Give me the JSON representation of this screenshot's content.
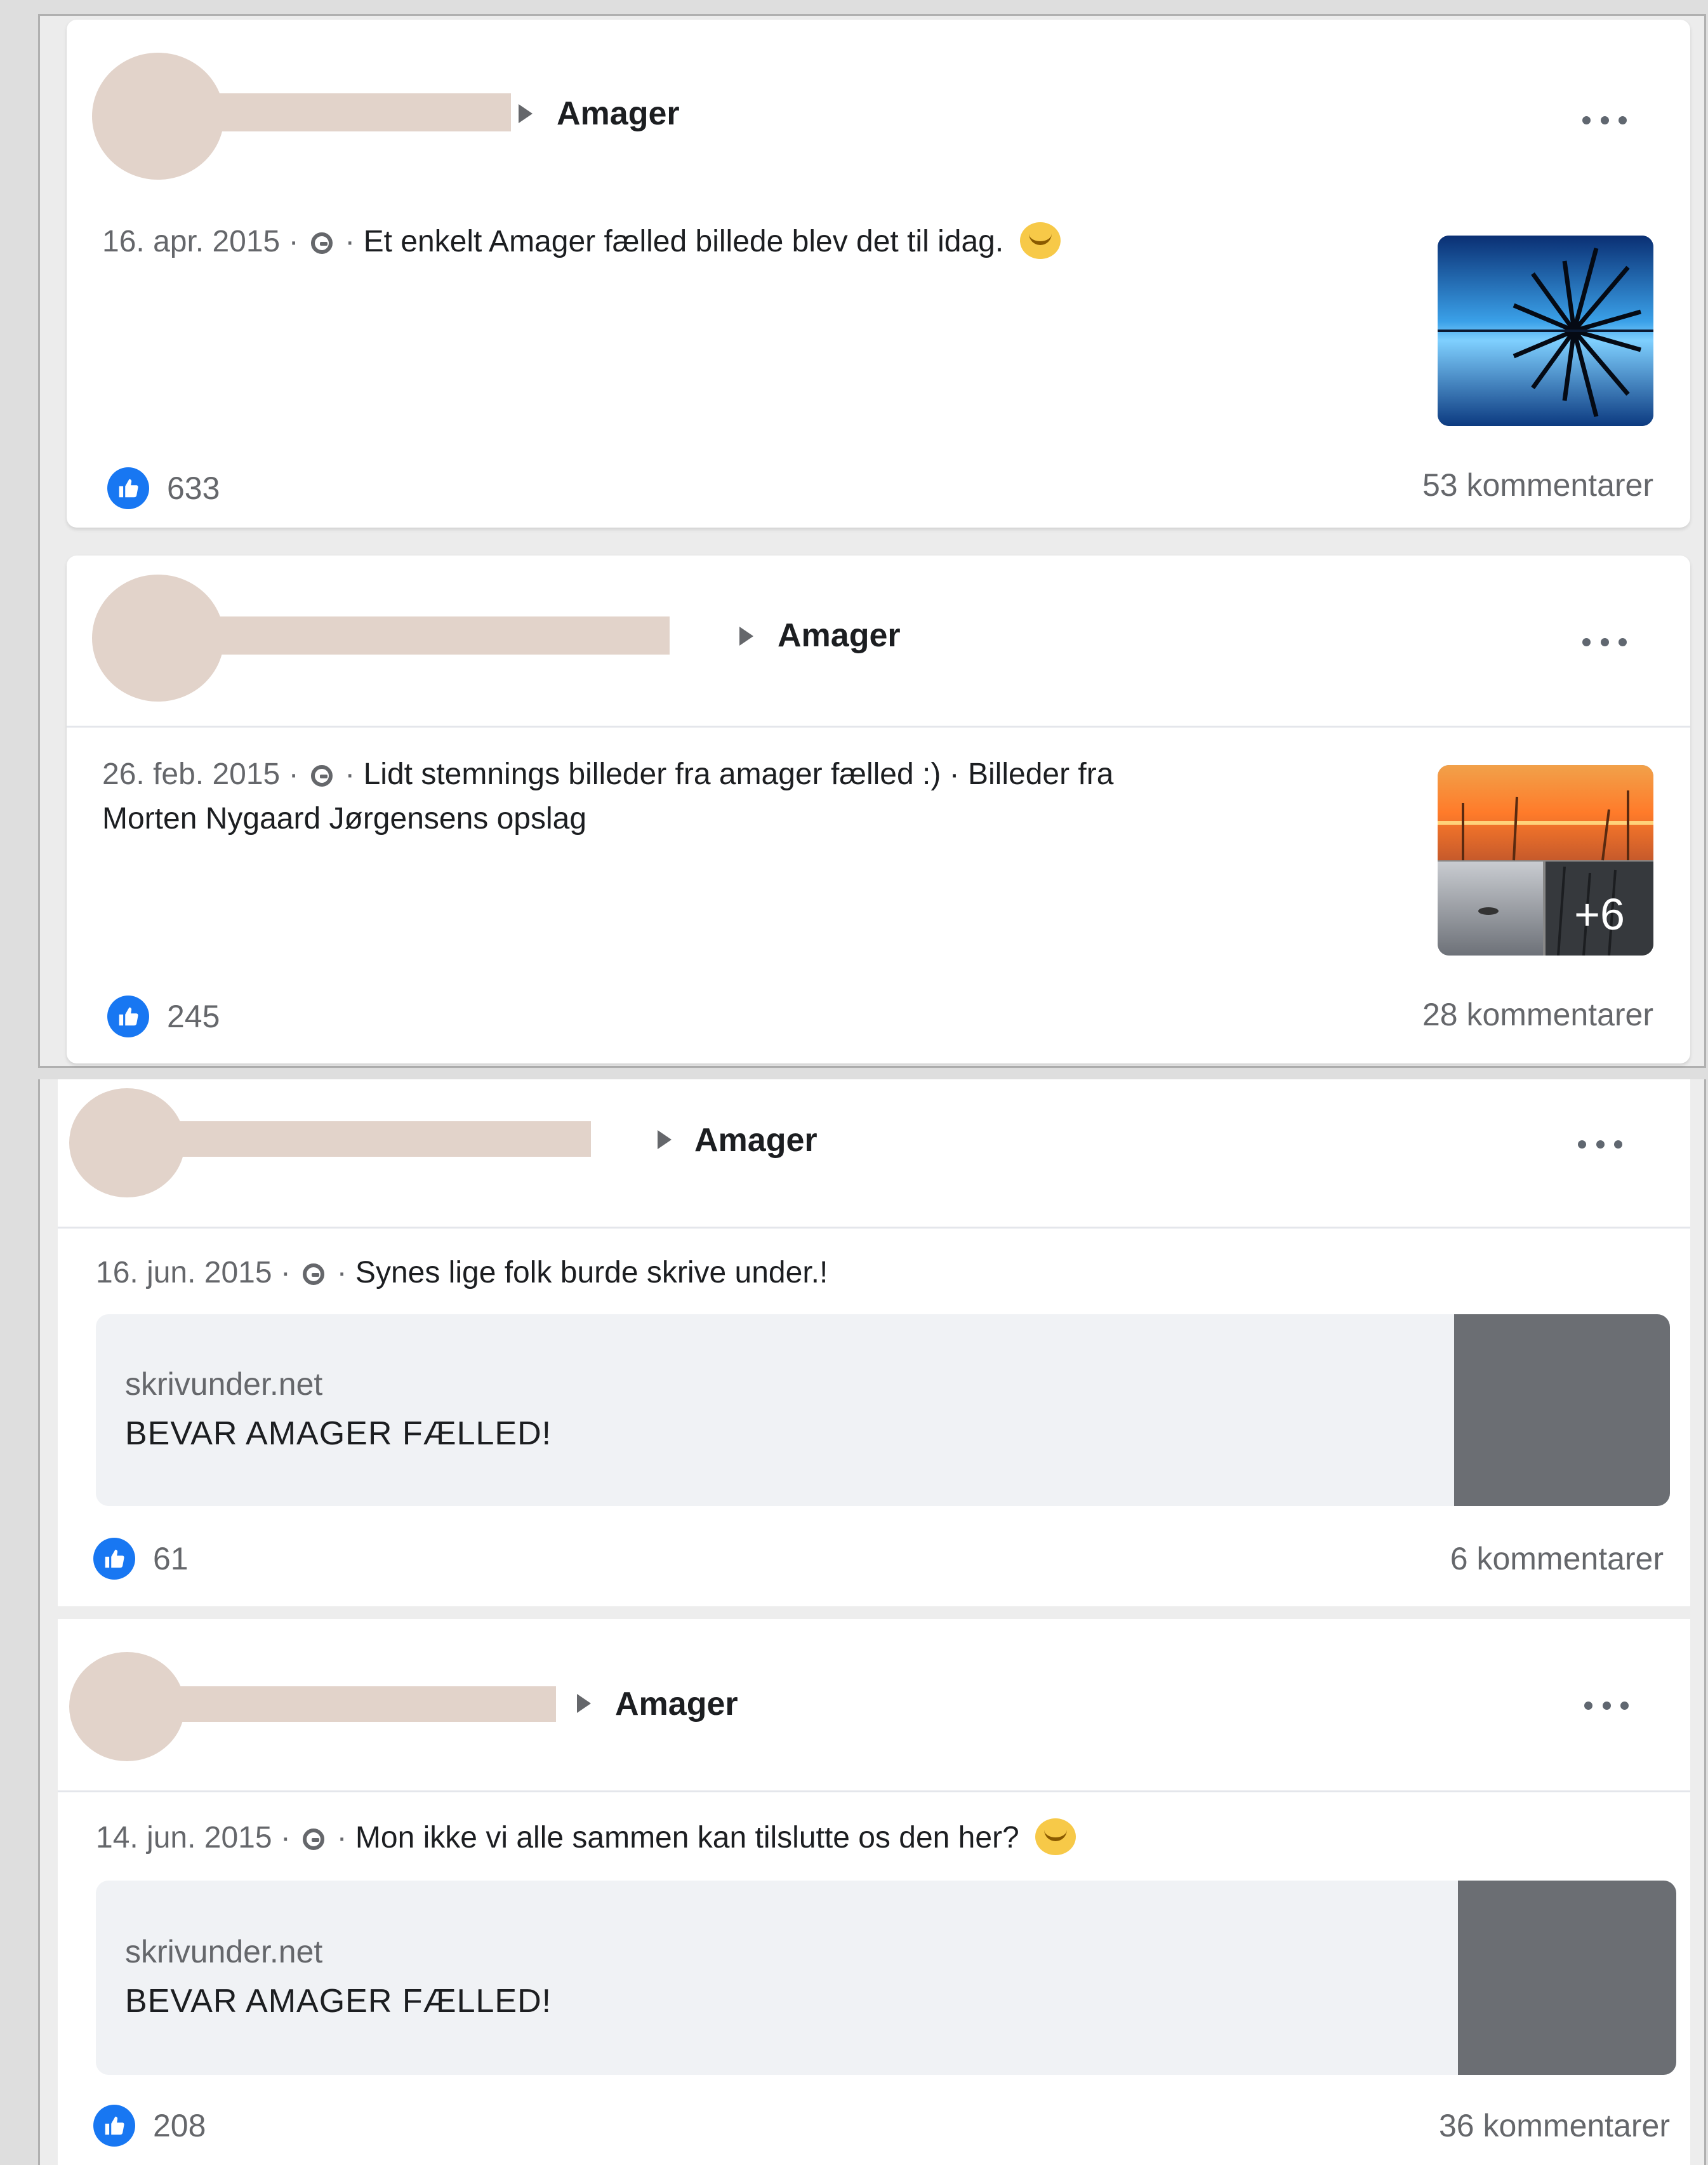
{
  "posts": [
    {
      "group": "Amager",
      "date": "16. apr. 2015",
      "separator": "·",
      "text": "Et enkelt Amager fælled billede blev det til idag.",
      "likes": "633",
      "comments": "53 kommentarer"
    },
    {
      "group": "Amager",
      "date": "26. feb. 2015",
      "separator": "·",
      "text": "Lidt stemnings billeder fra amager fælled :) · Billeder fra",
      "text_line2": "Morten Nygaard Jørgensens opslag",
      "extra_photos": "+6",
      "likes": "245",
      "comments": "28 kommentarer"
    },
    {
      "group": "Amager",
      "date": "16. jun. 2015",
      "separator": "·",
      "text": "Synes lige folk burde skrive under.!",
      "link_domain": "skrivunder.net",
      "link_title": "BEVAR AMAGER FÆLLED!",
      "likes": "61",
      "comments": "6 kommentarer"
    },
    {
      "group": "Amager",
      "date": "14. jun. 2015",
      "separator": "·",
      "text": "Mon ikke vi alle sammen kan tilslutte os den her?",
      "link_domain": "skrivunder.net",
      "link_title": "BEVAR AMAGER FÆLLED!",
      "likes": "208",
      "comments": "36 kommentarer"
    }
  ],
  "icons": {
    "privacy": "globe-icon",
    "reaction": "like-icon",
    "menu": "more-options-icon",
    "caret": "caret-right-icon"
  },
  "colors": {
    "like_blue": "#1877f2",
    "redaction": "#e2d3ca"
  }
}
